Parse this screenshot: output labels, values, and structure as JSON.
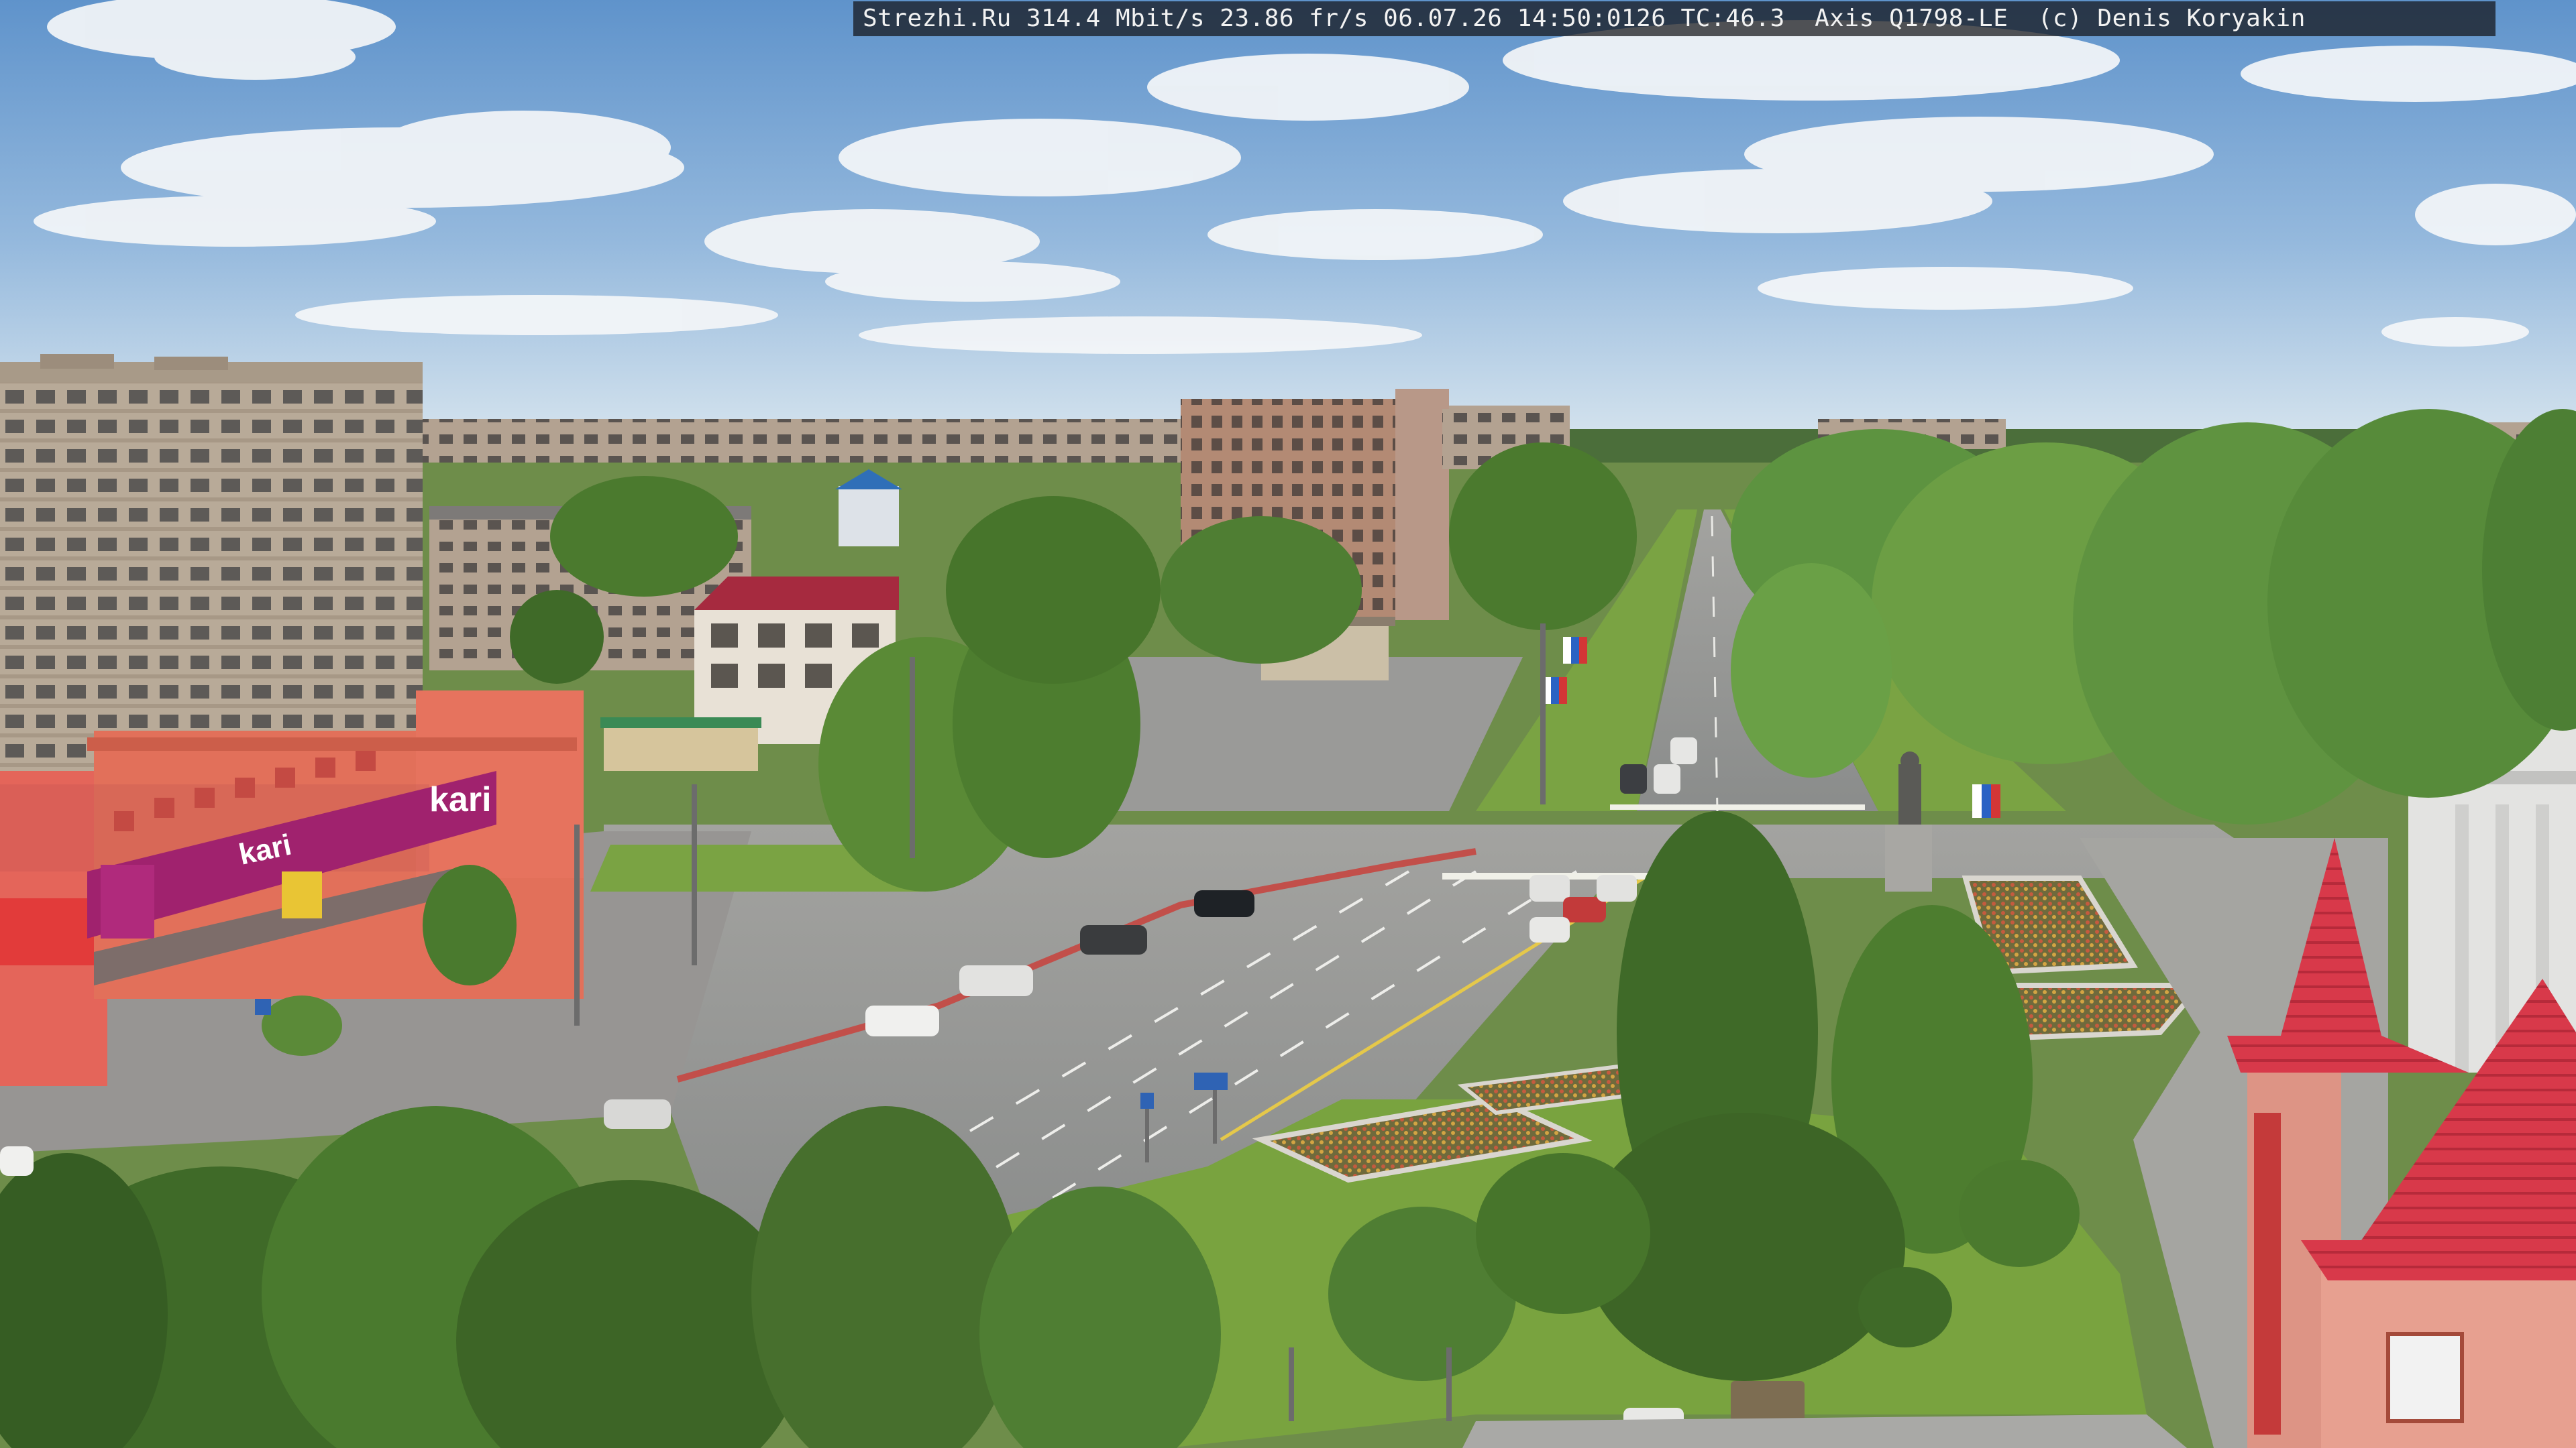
{
  "overlay": {
    "text": "Strezhi.Ru 314.4 Mbit/s 23.86 fr/s 06.07.26 14:50:0126 TC:46.3  Axis Q1798-LE  (c) Denis Koryakin"
  },
  "storefront": {
    "brand": "kari"
  },
  "colors": {
    "sky_top": "#6f9fd0",
    "sky_bottom": "#cfe0ef",
    "asphalt": "#8d9090",
    "grass": "#6f9a3a",
    "tree_dark": "#3f6a28",
    "tree_light": "#6c9a3e",
    "building_beige": "#b9aa99",
    "roof_red": "#d63a4a",
    "kari_magenta": "#a0226e",
    "store_orange": "#e2705a"
  },
  "icons": {
    "road_sign": "road-sign-icon",
    "flag": "flag-icon"
  }
}
